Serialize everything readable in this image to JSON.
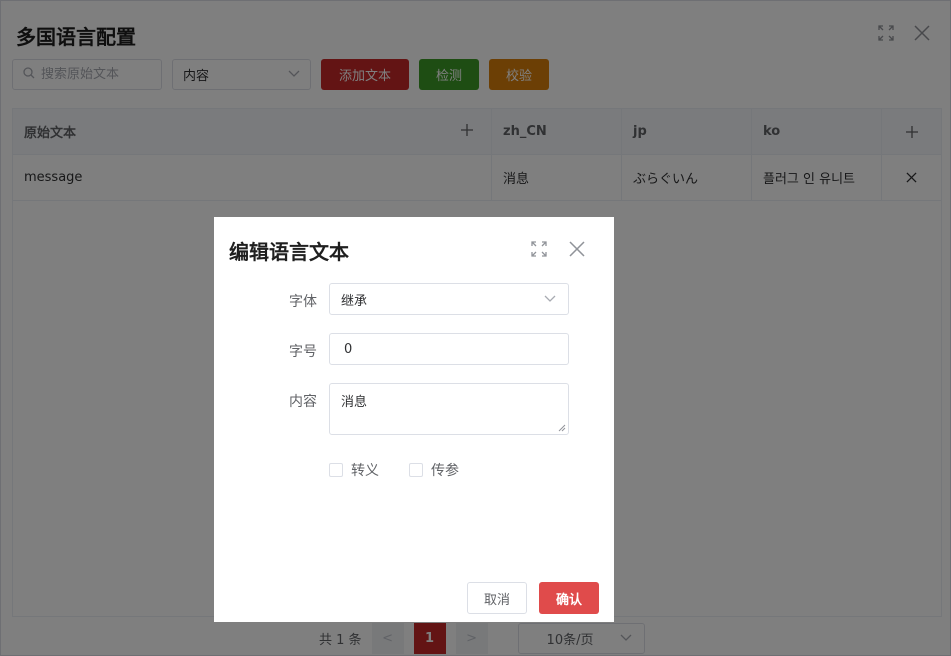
{
  "window": {
    "title": "多国语言配置",
    "toolbar": {
      "search_placeholder": "搜索原始文本",
      "filter_select": "内容",
      "add_text_label": "添加文本",
      "detect_label": "检测",
      "verify_label": "校验"
    },
    "table": {
      "columns": [
        "原始文本",
        "zh_CN",
        "jp",
        "ko"
      ],
      "rows": [
        {
          "original": "message",
          "zh_CN": "消息",
          "jp": "ぶらぐいん",
          "ko": "플러그 인 유니트"
        }
      ]
    },
    "pagination": {
      "total": "共 1 条",
      "current_page": "1",
      "page_size": "10条/页",
      "prev": "<",
      "next": ">"
    }
  },
  "dialog": {
    "title": "编辑语言文本",
    "font_label": "字体",
    "font_value": "继承",
    "size_label": "字号",
    "size_value": "0",
    "content_label": "内容",
    "content_value": "消息",
    "escape_label": "转义",
    "param_label": "传参",
    "cancel_label": "取消",
    "confirm_label": "确认"
  },
  "colors": {
    "primary_red": "#c62828",
    "green": "#3c9b26",
    "orange": "#d97e0a",
    "confirm_red": "#e04b4b"
  }
}
